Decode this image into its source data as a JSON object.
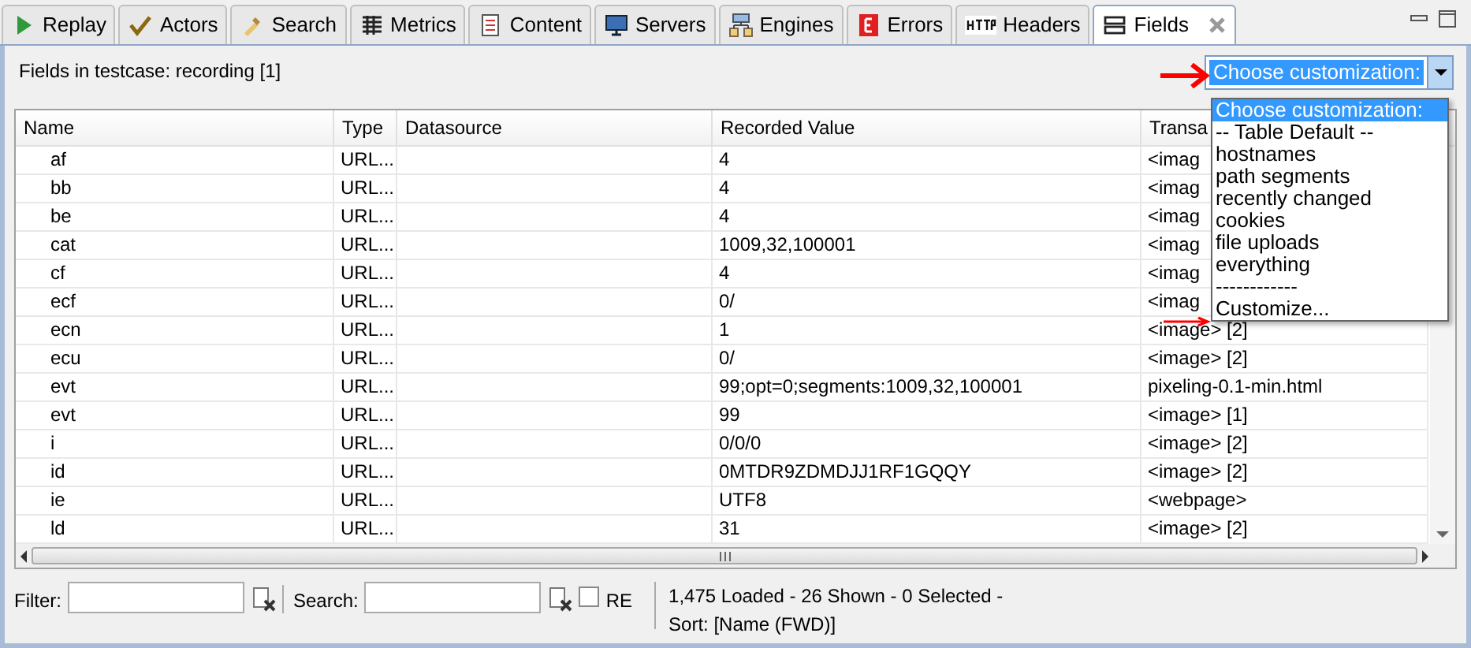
{
  "tabs": [
    {
      "label": "Replay",
      "selected": false
    },
    {
      "label": "Actors",
      "selected": false
    },
    {
      "label": "Search",
      "selected": false
    },
    {
      "label": "Metrics",
      "selected": false
    },
    {
      "label": "Content",
      "selected": false
    },
    {
      "label": "Servers",
      "selected": false
    },
    {
      "label": "Engines",
      "selected": false
    },
    {
      "label": "Errors",
      "selected": false
    },
    {
      "label": "Headers",
      "selected": false
    },
    {
      "label": "Fields",
      "selected": true
    }
  ],
  "heading": "Fields in testcase: recording [1]",
  "customization": {
    "value": "Choose customization:",
    "expanded": true,
    "options": [
      {
        "label": "Choose customization:",
        "selected": true
      },
      {
        "label": "-- Table Default --",
        "selected": false
      },
      {
        "label": "hostnames",
        "selected": false
      },
      {
        "label": "path segments",
        "selected": false
      },
      {
        "label": "recently changed",
        "selected": false
      },
      {
        "label": "cookies",
        "selected": false
      },
      {
        "label": "file uploads",
        "selected": false
      },
      {
        "label": "everything",
        "selected": false
      },
      {
        "label": "------------",
        "selected": false
      },
      {
        "label": "Customize...",
        "selected": false
      }
    ]
  },
  "table": {
    "columns": [
      "Name",
      "Type",
      "Datasource",
      "Recorded Value",
      "Transa"
    ],
    "rows": [
      [
        "af",
        "URL...",
        "",
        "4",
        "<imag"
      ],
      [
        "bb",
        "URL...",
        "",
        "4",
        "<imag"
      ],
      [
        "be",
        "URL...",
        "",
        "4",
        "<imag"
      ],
      [
        "cat",
        "URL...",
        "",
        "1009,32,100001",
        "<imag"
      ],
      [
        "cf",
        "URL...",
        "",
        "4",
        "<imag"
      ],
      [
        "ecf",
        "URL...",
        "",
        "0/",
        "<imag"
      ],
      [
        "ecn",
        "URL...",
        "",
        "1",
        "<image> [2]"
      ],
      [
        "ecu",
        "URL...",
        "",
        "0/",
        "<image> [2]"
      ],
      [
        "evt",
        "URL...",
        "",
        "99;opt=0;segments:1009,32,100001",
        "pixeling-0.1-min.html"
      ],
      [
        "evt",
        "URL...",
        "",
        "99",
        "<image> [1]"
      ],
      [
        "i",
        "URL...",
        "",
        "0/0/0",
        "<image> [2]"
      ],
      [
        "id",
        "URL...",
        "",
        "0MTDR9ZDMDJJ1RF1GQQY",
        "<image> [2]"
      ],
      [
        "ie",
        "URL...",
        "",
        "UTF8",
        "<webpage>"
      ],
      [
        "ld",
        "URL...",
        "",
        "31",
        "<image> [2]"
      ]
    ]
  },
  "filter": {
    "label": "Filter:"
  },
  "search": {
    "label": "Search:"
  },
  "regex": {
    "label": "RE",
    "checked": false
  },
  "status": [
    "1,475 Loaded - 26 Shown - 0 Selected -",
    "Sort: [Name (FWD)]"
  ]
}
